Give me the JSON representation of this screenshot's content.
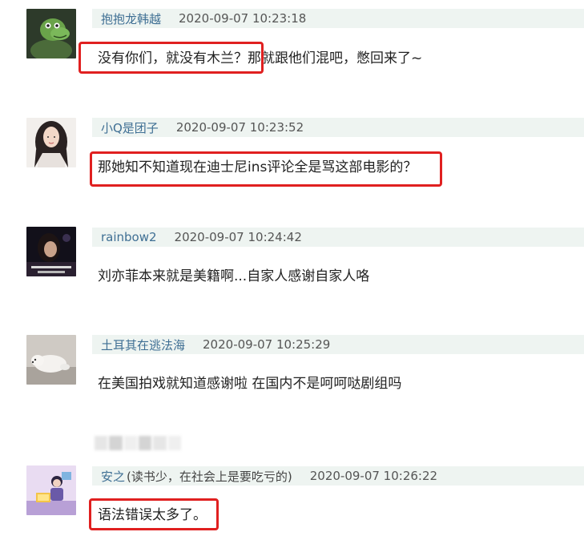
{
  "comments": [
    {
      "author": "抱抱龙韩越",
      "note": "",
      "time": "2020-09-07 10:23:18",
      "text": "没有你们，就没有木兰？那就跟他们混吧，憋回来了~",
      "avatar": "green-dinosaur-icon"
    },
    {
      "author": "小Q是团子",
      "note": "",
      "time": "2020-09-07 10:23:52",
      "text": "那她知不知道现在迪士尼ins评论全是骂这部电影的？",
      "avatar": "girl-portrait-icon"
    },
    {
      "author": "rainbow2",
      "note": "",
      "time": "2020-09-07 10:24:42",
      "text": "刘亦菲本来就是美籍啊...自家人感谢自家人咯",
      "avatar": "film-still-icon"
    },
    {
      "author": "土耳其在逃法海",
      "note": "",
      "time": "2020-09-07 10:25:29",
      "text": "在美国拍戏就知道感谢啦 在国内不是呵呵哒剧组吗",
      "avatar": "white-dog-icon"
    },
    {
      "author": "安之",
      "note": "(读书少，在社会上是要吃亏的)",
      "time": "2020-09-07 10:26:22",
      "text": "语法错误太多了。",
      "avatar": "reading-girl-illustration-icon"
    }
  ],
  "colors": {
    "meta_bar": "#eef4f1",
    "author": "#3f6f94",
    "highlight": "#e02020",
    "body_text": "#222222"
  }
}
